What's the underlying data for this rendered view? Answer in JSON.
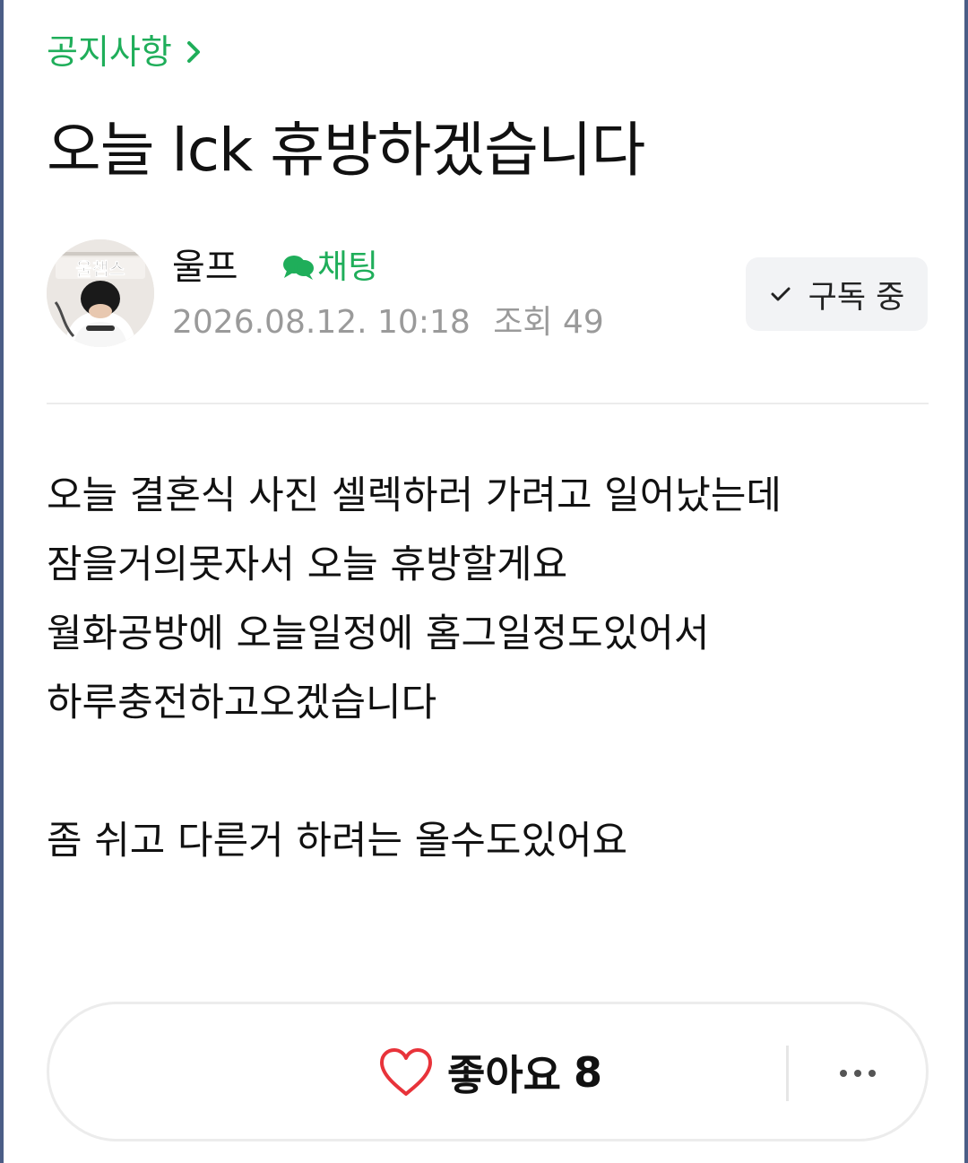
{
  "board": {
    "name": "공지사항",
    "chevron_icon": "chevron-right-icon"
  },
  "post": {
    "title": "오늘 lck 휴방하겠습니다",
    "author": {
      "name": "울프",
      "chat_label": "채팅",
      "avatar_badge_text": "울챔스"
    },
    "date": "2026.08.12. 10:18",
    "views_label": "조회",
    "views_count": "49",
    "subscribe_label": "구독 중",
    "body_lines": [
      "오늘 결혼식 사진 셀렉하러 가려고 일어났는데",
      "잠을거의못자서 오늘 휴방할게요",
      "월화공방에 오늘일정에 홈그일정도있어서",
      "하루충전하고오겠습니다",
      "",
      "좀 쉬고 다른거 하려는 올수도있어요"
    ]
  },
  "actions": {
    "like_label": "좋아요",
    "like_count": "8",
    "like_icon": "heart-outline-icon",
    "more_icon": "more-dots-icon"
  },
  "colors": {
    "accent_green": "#1fae5a",
    "like_red": "#e8333a",
    "meta_gray": "#9a9a9a",
    "frame_border": "#4b5d86"
  }
}
